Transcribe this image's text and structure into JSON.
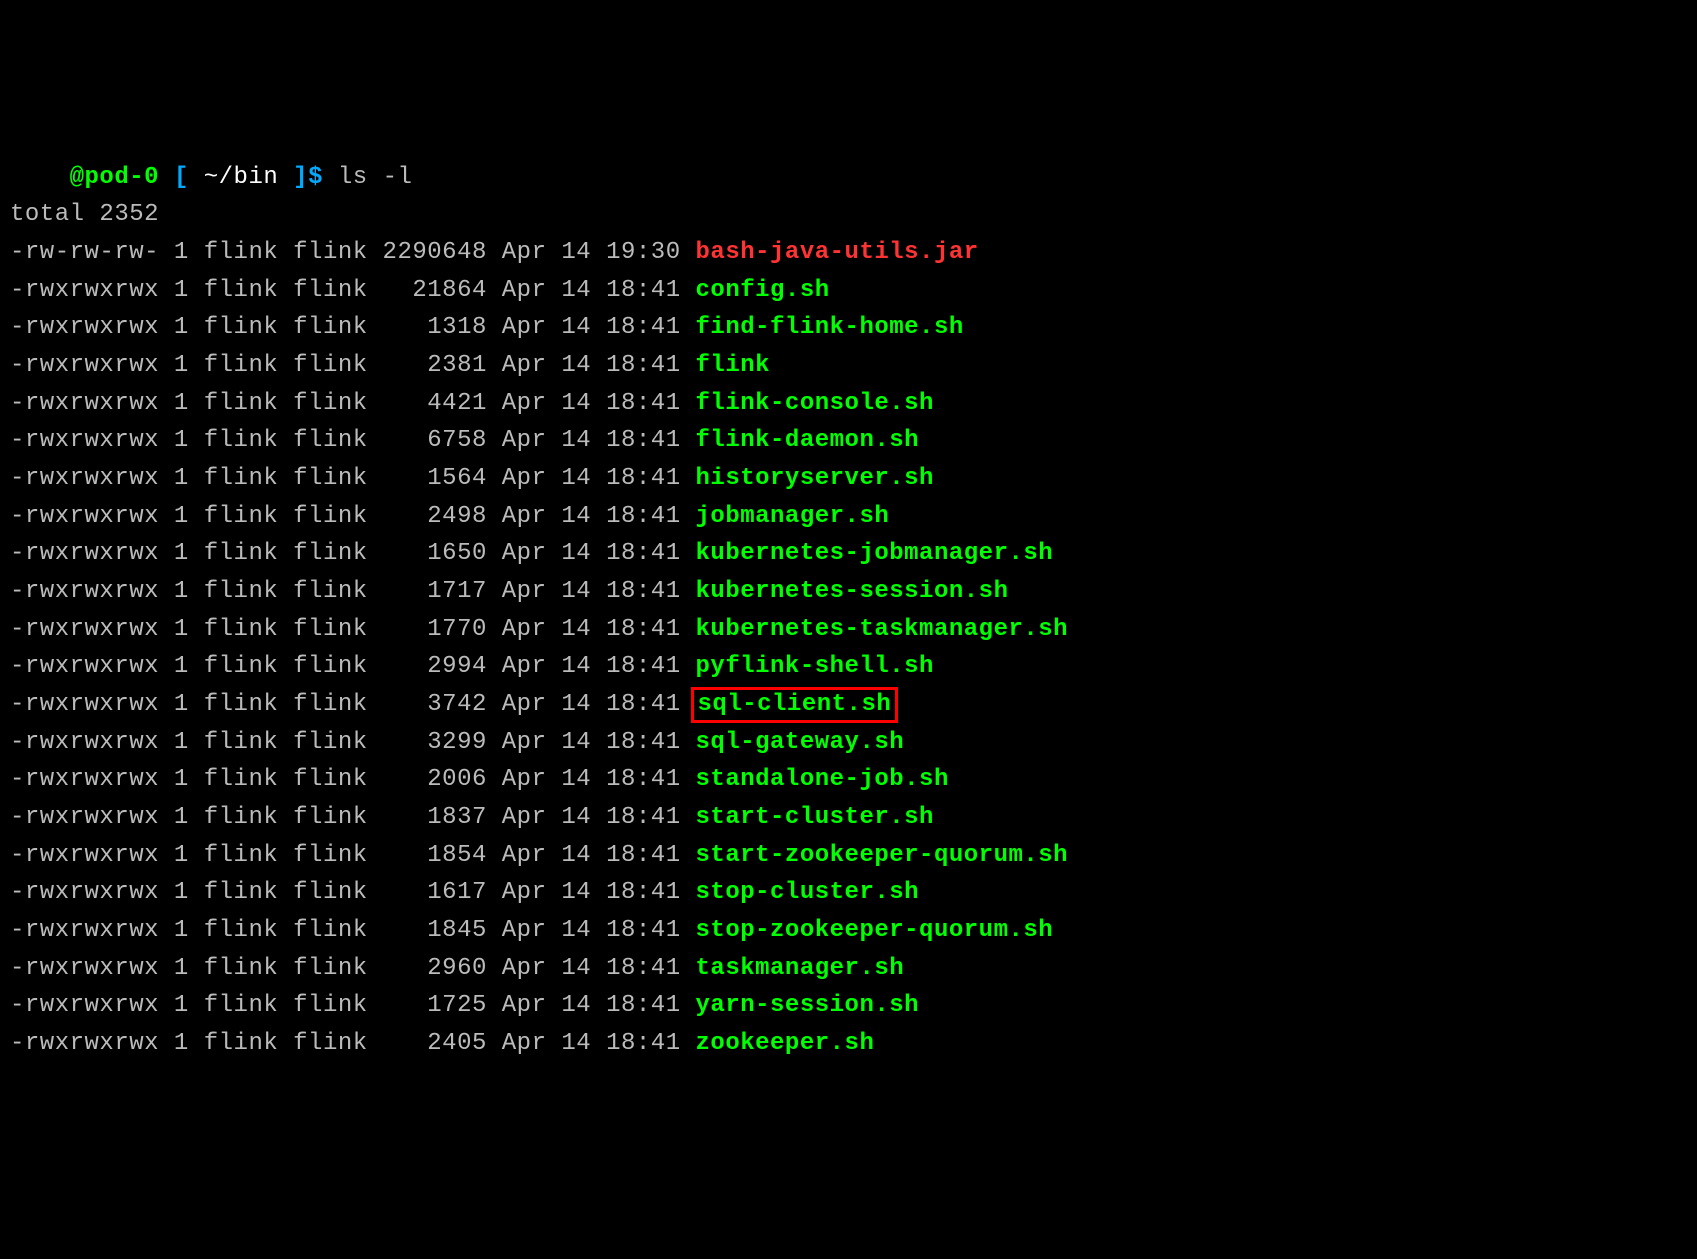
{
  "prompt": {
    "host": "@pod-0",
    "lbracket": "[",
    "path": "~/bin",
    "rbracket": "]$",
    "command": "ls -l"
  },
  "total_line": "total 2352",
  "rows": [
    {
      "perm": "-rw-rw-rw-",
      "links": "1",
      "owner": "flink",
      "group": "flink",
      "size": "2290648",
      "month": "Apr",
      "day": "14",
      "time": "19:30",
      "name": "bash-java-utils.jar",
      "style": "red",
      "highlighted": false
    },
    {
      "perm": "-rwxrwxrwx",
      "links": "1",
      "owner": "flink",
      "group": "flink",
      "size": "21864",
      "month": "Apr",
      "day": "14",
      "time": "18:41",
      "name": "config.sh",
      "style": "exec",
      "highlighted": false
    },
    {
      "perm": "-rwxrwxrwx",
      "links": "1",
      "owner": "flink",
      "group": "flink",
      "size": "1318",
      "month": "Apr",
      "day": "14",
      "time": "18:41",
      "name": "find-flink-home.sh",
      "style": "exec",
      "highlighted": false
    },
    {
      "perm": "-rwxrwxrwx",
      "links": "1",
      "owner": "flink",
      "group": "flink",
      "size": "2381",
      "month": "Apr",
      "day": "14",
      "time": "18:41",
      "name": "flink",
      "style": "exec",
      "highlighted": false
    },
    {
      "perm": "-rwxrwxrwx",
      "links": "1",
      "owner": "flink",
      "group": "flink",
      "size": "4421",
      "month": "Apr",
      "day": "14",
      "time": "18:41",
      "name": "flink-console.sh",
      "style": "exec",
      "highlighted": false
    },
    {
      "perm": "-rwxrwxrwx",
      "links": "1",
      "owner": "flink",
      "group": "flink",
      "size": "6758",
      "month": "Apr",
      "day": "14",
      "time": "18:41",
      "name": "flink-daemon.sh",
      "style": "exec",
      "highlighted": false
    },
    {
      "perm": "-rwxrwxrwx",
      "links": "1",
      "owner": "flink",
      "group": "flink",
      "size": "1564",
      "month": "Apr",
      "day": "14",
      "time": "18:41",
      "name": "historyserver.sh",
      "style": "exec",
      "highlighted": false
    },
    {
      "perm": "-rwxrwxrwx",
      "links": "1",
      "owner": "flink",
      "group": "flink",
      "size": "2498",
      "month": "Apr",
      "day": "14",
      "time": "18:41",
      "name": "jobmanager.sh",
      "style": "exec",
      "highlighted": false
    },
    {
      "perm": "-rwxrwxrwx",
      "links": "1",
      "owner": "flink",
      "group": "flink",
      "size": "1650",
      "month": "Apr",
      "day": "14",
      "time": "18:41",
      "name": "kubernetes-jobmanager.sh",
      "style": "exec",
      "highlighted": false
    },
    {
      "perm": "-rwxrwxrwx",
      "links": "1",
      "owner": "flink",
      "group": "flink",
      "size": "1717",
      "month": "Apr",
      "day": "14",
      "time": "18:41",
      "name": "kubernetes-session.sh",
      "style": "exec",
      "highlighted": false
    },
    {
      "perm": "-rwxrwxrwx",
      "links": "1",
      "owner": "flink",
      "group": "flink",
      "size": "1770",
      "month": "Apr",
      "day": "14",
      "time": "18:41",
      "name": "kubernetes-taskmanager.sh",
      "style": "exec",
      "highlighted": false
    },
    {
      "perm": "-rwxrwxrwx",
      "links": "1",
      "owner": "flink",
      "group": "flink",
      "size": "2994",
      "month": "Apr",
      "day": "14",
      "time": "18:41",
      "name": "pyflink-shell.sh",
      "style": "exec",
      "highlighted": false
    },
    {
      "perm": "-rwxrwxrwx",
      "links": "1",
      "owner": "flink",
      "group": "flink",
      "size": "3742",
      "month": "Apr",
      "day": "14",
      "time": "18:41",
      "name": "sql-client.sh",
      "style": "exec",
      "highlighted": true
    },
    {
      "perm": "-rwxrwxrwx",
      "links": "1",
      "owner": "flink",
      "group": "flink",
      "size": "3299",
      "month": "Apr",
      "day": "14",
      "time": "18:41",
      "name": "sql-gateway.sh",
      "style": "exec",
      "highlighted": false
    },
    {
      "perm": "-rwxrwxrwx",
      "links": "1",
      "owner": "flink",
      "group": "flink",
      "size": "2006",
      "month": "Apr",
      "day": "14",
      "time": "18:41",
      "name": "standalone-job.sh",
      "style": "exec",
      "highlighted": false
    },
    {
      "perm": "-rwxrwxrwx",
      "links": "1",
      "owner": "flink",
      "group": "flink",
      "size": "1837",
      "month": "Apr",
      "day": "14",
      "time": "18:41",
      "name": "start-cluster.sh",
      "style": "exec",
      "highlighted": false
    },
    {
      "perm": "-rwxrwxrwx",
      "links": "1",
      "owner": "flink",
      "group": "flink",
      "size": "1854",
      "month": "Apr",
      "day": "14",
      "time": "18:41",
      "name": "start-zookeeper-quorum.sh",
      "style": "exec",
      "highlighted": false
    },
    {
      "perm": "-rwxrwxrwx",
      "links": "1",
      "owner": "flink",
      "group": "flink",
      "size": "1617",
      "month": "Apr",
      "day": "14",
      "time": "18:41",
      "name": "stop-cluster.sh",
      "style": "exec",
      "highlighted": false
    },
    {
      "perm": "-rwxrwxrwx",
      "links": "1",
      "owner": "flink",
      "group": "flink",
      "size": "1845",
      "month": "Apr",
      "day": "14",
      "time": "18:41",
      "name": "stop-zookeeper-quorum.sh",
      "style": "exec",
      "highlighted": false
    },
    {
      "perm": "-rwxrwxrwx",
      "links": "1",
      "owner": "flink",
      "group": "flink",
      "size": "2960",
      "month": "Apr",
      "day": "14",
      "time": "18:41",
      "name": "taskmanager.sh",
      "style": "exec",
      "highlighted": false
    },
    {
      "perm": "-rwxrwxrwx",
      "links": "1",
      "owner": "flink",
      "group": "flink",
      "size": "1725",
      "month": "Apr",
      "day": "14",
      "time": "18:41",
      "name": "yarn-session.sh",
      "style": "exec",
      "highlighted": false
    },
    {
      "perm": "-rwxrwxrwx",
      "links": "1",
      "owner": "flink",
      "group": "flink",
      "size": "2405",
      "month": "Apr",
      "day": "14",
      "time": "18:41",
      "name": "zookeeper.sh",
      "style": "exec",
      "highlighted": false
    }
  ]
}
